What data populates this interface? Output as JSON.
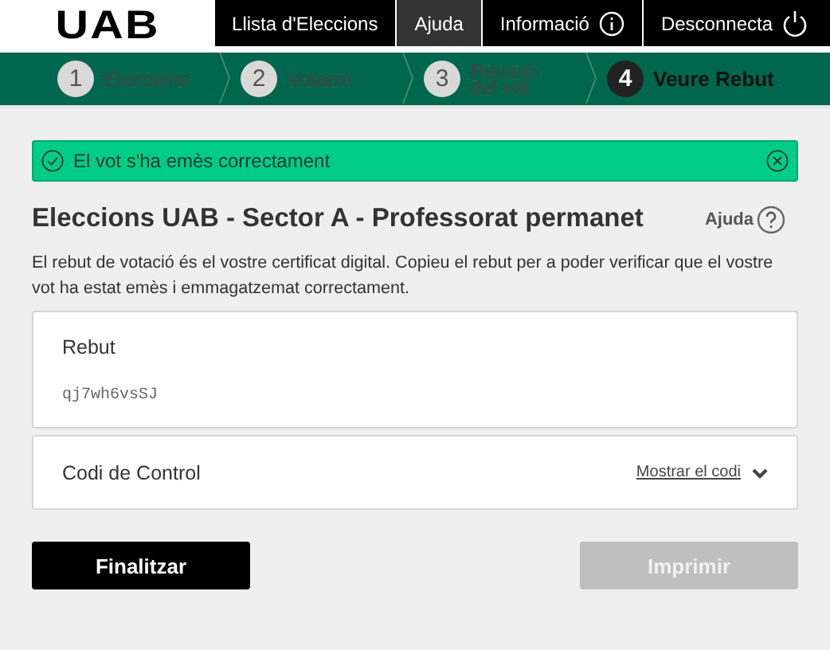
{
  "logo": "UAB",
  "nav": [
    {
      "label": "Llista d'Eleccions",
      "selected": false,
      "kind": "plain"
    },
    {
      "label": "Ajuda",
      "selected": true,
      "kind": "plain"
    },
    {
      "label": "Informació",
      "selected": false,
      "kind": "info"
    },
    {
      "label": "Desconnecta",
      "selected": false,
      "kind": "logout"
    }
  ],
  "steps": [
    {
      "number": "1",
      "label": "Eleccions",
      "selected": false
    },
    {
      "number": "2",
      "label": "Votació",
      "selected": false
    },
    {
      "number": "3",
      "label": "Revisió del vot",
      "selected": false
    },
    {
      "number": "4",
      "label": "Veure Rebut",
      "selected": true
    }
  ],
  "alert": {
    "message": "El vot s'ha emès correctament"
  },
  "title": "Eleccions UAB - Sector A - Professorat permanet",
  "help": "Ajuda",
  "description": "El rebut de votació és el vostre certificat digital. Copieu el rebut per a poder verificar que el vostre vot ha estat emès i emmagatzemat correctament.",
  "receipt": {
    "heading": "Rebut",
    "code": "qj7wh6vsSJ"
  },
  "control_code": {
    "heading": "Codi de Control",
    "link": "Mostrar el codi",
    "expanded": false
  },
  "buttons": [
    {
      "label": "Finalitzar",
      "disabled": false
    },
    {
      "label": "Imprimir",
      "disabled": true
    }
  ]
}
